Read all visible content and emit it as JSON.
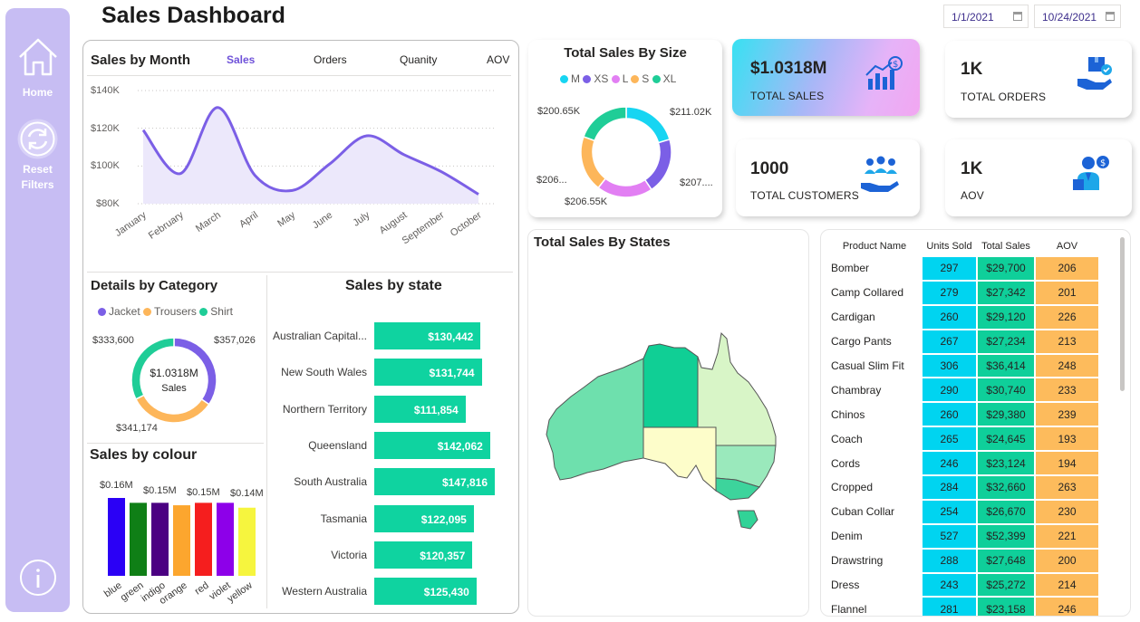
{
  "page_title": "Sales Dashboard",
  "dates": {
    "start": "1/1/2021",
    "end": "10/24/2021"
  },
  "sidebar": {
    "home_label": "Home",
    "reset_label_1": "Reset",
    "reset_label_2": "Filters"
  },
  "sales_by_month": {
    "title": "Sales by Month",
    "tabs": [
      "Sales",
      "Orders",
      "Quanity",
      "AOV"
    ],
    "active_tab": "Sales",
    "y_ticks": [
      "$140K",
      "$120K",
      "$100K",
      "$80K"
    ],
    "chart_data": {
      "type": "area",
      "categories": [
        "January",
        "February",
        "March",
        "April",
        "May",
        "June",
        "July",
        "August",
        "September",
        "October"
      ],
      "values": [
        119000,
        96000,
        131000,
        95000,
        87000,
        101000,
        116000,
        106000,
        97000,
        85000
      ],
      "ylim": [
        80000,
        140000
      ],
      "color": "#7b5fe6",
      "grid": true
    }
  },
  "total_sales_by_size": {
    "title": "Total Sales By Size",
    "labels": [
      "$211.02K",
      "$207....",
      "$206.55K",
      "$206...",
      "$200.65K"
    ],
    "chart_data": {
      "type": "pie",
      "labels": [
        "M",
        "XS",
        "L",
        "S",
        "XL"
      ],
      "values": [
        211.02,
        207.0,
        206.55,
        206.0,
        200.65
      ],
      "units": "K",
      "colors": [
        "#17d5f2",
        "#7b5fe6",
        "#e27ff3",
        "#fdb65a",
        "#1fcd97"
      ]
    }
  },
  "kpis": [
    {
      "value": "$1.0318M",
      "label": "TOTAL SALES",
      "icon": "chart-money-icon"
    },
    {
      "value": "1K",
      "label": "TOTAL ORDERS",
      "icon": "box-hand-icon"
    },
    {
      "value": "1000",
      "label": "TOTAL CUSTOMERS",
      "icon": "customers-hand-icon"
    },
    {
      "value": "1K",
      "label": "AOV",
      "icon": "person-money-icon"
    }
  ],
  "details_by_category": {
    "title": "Details by Category",
    "center_value": "$1.0318M",
    "center_label": "Sales",
    "labels": [
      "$357,026",
      "$341,174",
      "$333,600"
    ],
    "chart_data": {
      "type": "pie",
      "labels": [
        "Jacket",
        "Trousers",
        "Shirt"
      ],
      "values": [
        357026,
        341174,
        333600
      ],
      "colors": [
        "#7b5fe6",
        "#fdb65a",
        "#1fcd97"
      ]
    }
  },
  "sales_by_colour": {
    "title": "Sales by colour",
    "value_labels": [
      "$0.16M",
      "$0.15M",
      "$0.15M",
      "$0.14M"
    ],
    "chart_data": {
      "type": "bar",
      "categories": [
        "blue",
        "green",
        "indigo",
        "orange",
        "red",
        "violet",
        "yellow"
      ],
      "values": [
        0.16,
        0.15,
        0.15,
        0.145,
        0.15,
        0.15,
        0.14
      ],
      "units": "M",
      "colors": [
        "#2b00f5",
        "#0f7f16",
        "#4b0082",
        "#fca62e",
        "#f51e1e",
        "#8d00e9",
        "#f6f53e"
      ]
    }
  },
  "sales_by_state": {
    "title": "Sales by state",
    "value_labels": [
      "$130,442",
      "$131,744",
      "$111,854",
      "$142,062",
      "$147,816",
      "$122,095",
      "$120,357",
      "$125,430"
    ],
    "chart_data": {
      "type": "bar",
      "orientation": "horizontal",
      "categories": [
        "Australian Capital...",
        "New South Wales",
        "Northern Territory",
        "Queensland",
        "South Australia",
        "Tasmania",
        "Victoria",
        "Western Australia"
      ],
      "values": [
        130442,
        131744,
        111854,
        142062,
        147816,
        122095,
        120357,
        125430
      ],
      "color": "#0fd3a0"
    }
  },
  "total_sales_by_states": {
    "title": "Total Sales By States"
  },
  "product_table": {
    "headers": [
      "Product Name",
      "Units Sold",
      "Total Sales",
      "AOV"
    ],
    "rows": [
      [
        "Bomber",
        "297",
        "$29,700",
        "206"
      ],
      [
        "Camp Collared",
        "279",
        "$27,342",
        "201"
      ],
      [
        "Cardigan",
        "260",
        "$29,120",
        "226"
      ],
      [
        "Cargo Pants",
        "267",
        "$27,234",
        "213"
      ],
      [
        "Casual Slim Fit",
        "306",
        "$36,414",
        "248"
      ],
      [
        "Chambray",
        "290",
        "$30,740",
        "233"
      ],
      [
        "Chinos",
        "260",
        "$29,380",
        "239"
      ],
      [
        "Coach",
        "265",
        "$24,645",
        "193"
      ],
      [
        "Cords",
        "246",
        "$23,124",
        "194"
      ],
      [
        "Cropped",
        "284",
        "$32,660",
        "263"
      ],
      [
        "Cuban Collar",
        "254",
        "$26,670",
        "230"
      ],
      [
        "Denim",
        "527",
        "$52,399",
        "221"
      ],
      [
        "Drawstring",
        "288",
        "$27,648",
        "200"
      ],
      [
        "Dress",
        "243",
        "$25,272",
        "214"
      ],
      [
        "Flannel",
        "281",
        "$23,158",
        "246"
      ]
    ]
  }
}
